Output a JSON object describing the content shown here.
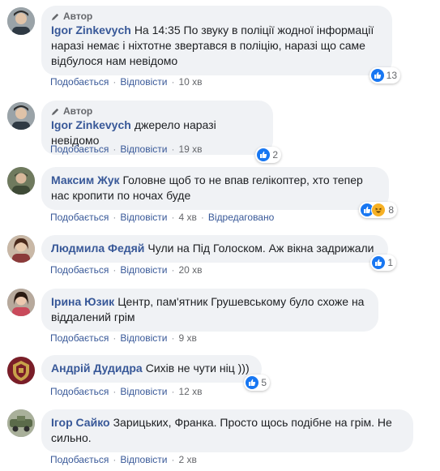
{
  "comments": [
    {
      "badge": "Автор",
      "name": "Igor Zinkevych",
      "text": "На 14:35 По звуку в поліції жодної інформації наразі немає і ніхтотне звертався в поліцію, наразі що саме відбулося нам невідомо",
      "like": "Подобається",
      "reply": "Відповісти",
      "time": "10 хв",
      "reactions": "13",
      "reaction_types": [
        "like"
      ]
    },
    {
      "badge": "Автор",
      "name": "Igor Zinkevych",
      "text": "джерело наразі невідомо",
      "like": "Подобається",
      "reply": "Відповісти",
      "time": "19 хв",
      "reactions": "2",
      "reaction_types": [
        "like"
      ]
    },
    {
      "name": "Максим Жук",
      "text": "Головне щоб то не впав гелікоптер, хто тепер нас кропити по ночах буде",
      "like": "Подобається",
      "reply": "Відповісти",
      "time": "4 хв",
      "edited": "Відредаговано",
      "reactions": "8",
      "reaction_types": [
        "like",
        "haha"
      ]
    },
    {
      "name": "Людмила Федяй",
      "text": "Чули на Під Голоском. Аж вікна задрижали",
      "like": "Подобається",
      "reply": "Відповісти",
      "time": "20 хв",
      "reactions": "1",
      "reaction_types": [
        "like"
      ]
    },
    {
      "name": "Ірина Юзик",
      "text": "Центр, пам'ятник Грушевському було схоже на віддалений грім",
      "like": "Подобається",
      "reply": "Відповісти",
      "time": "9 хв"
    },
    {
      "name": "Андрій Дудидра",
      "text": "Сихів не чути ніц )))",
      "like": "Подобається",
      "reply": "Відповісти",
      "time": "12 хв",
      "reactions": "5",
      "reaction_types": [
        "like"
      ]
    },
    {
      "name": "Ігор Сайко",
      "text": "Зарицьких, Франка. Просто щось подібне на грім. Не сильно.",
      "like": "Подобається",
      "reply": "Відповісти",
      "time": "2 хв"
    }
  ],
  "colors": {
    "name_link": "#385898",
    "bubble_bg": "#f0f2f5",
    "like_blue": "#1877f2",
    "meta_gray": "#65676b"
  },
  "icons": {
    "badge": "pencil-icon",
    "like_reaction": "thumbs-up-icon",
    "haha_reaction": "laughing-face-icon"
  }
}
